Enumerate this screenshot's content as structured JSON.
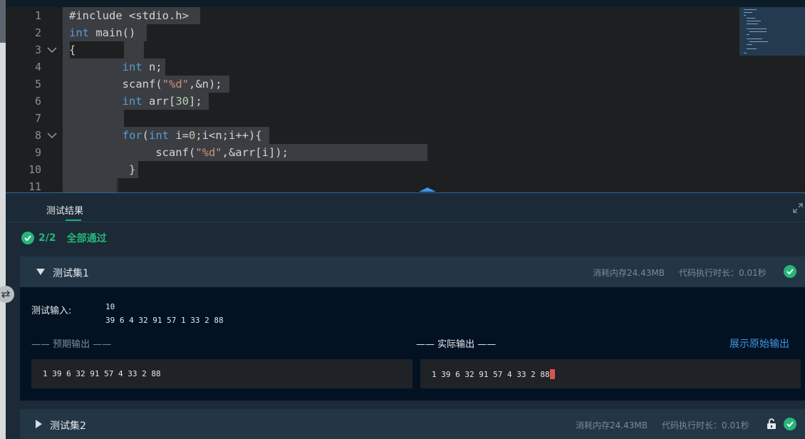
{
  "editor": {
    "line_numbers": [
      "1",
      "2",
      "3",
      "4",
      "5",
      "6",
      "7",
      "8",
      "9",
      "10",
      "11"
    ],
    "lines": [
      [
        {
          "t": "#include <stdio.h>",
          "c": ""
        }
      ],
      [
        {
          "t": "int",
          "c": "kw"
        },
        {
          "t": " main()",
          "c": ""
        }
      ],
      [
        {
          "t": "{",
          "c": ""
        }
      ],
      [
        {
          "t": "        ",
          "c": ""
        },
        {
          "t": "int",
          "c": "kw"
        },
        {
          "t": " n;",
          "c": ""
        }
      ],
      [
        {
          "t": "        scanf(",
          "c": ""
        },
        {
          "t": "\"%d\"",
          "c": "str"
        },
        {
          "t": ",&n);",
          "c": ""
        }
      ],
      [
        {
          "t": "        ",
          "c": ""
        },
        {
          "t": "int",
          "c": "kw"
        },
        {
          "t": " arr[",
          "c": ""
        },
        {
          "t": "30",
          "c": "num"
        },
        {
          "t": "];",
          "c": ""
        }
      ],
      [
        {
          "t": "",
          "c": ""
        }
      ],
      [
        {
          "t": "        ",
          "c": ""
        },
        {
          "t": "for",
          "c": "kw"
        },
        {
          "t": "(",
          "c": ""
        },
        {
          "t": "int",
          "c": "kw"
        },
        {
          "t": " i=",
          "c": ""
        },
        {
          "t": "0",
          "c": "num"
        },
        {
          "t": ";i<n;i++){",
          "c": ""
        }
      ],
      [
        {
          "t": "             scanf(",
          "c": ""
        },
        {
          "t": "\"%d\"",
          "c": "str"
        },
        {
          "t": ",&arr[i]);",
          "c": ""
        }
      ],
      [
        {
          "t": "         }",
          "c": ""
        }
      ],
      [
        {
          "t": "",
          "c": ""
        }
      ]
    ]
  },
  "results": {
    "tab_label": "测试结果",
    "passed_count": "2/2",
    "pass_text": "全部通过",
    "sets": [
      {
        "title": "测试集1",
        "memory": "消耗内存24.43MB",
        "time": "代码执行时长：0.01秒",
        "input_label": "测试输入:",
        "input_lines": [
          "10",
          "39 6 4 32 91 57 1 33 2 88"
        ],
        "expected_label": "—— 预期输出 ——",
        "actual_label": "—— 实际输出 ——",
        "raw_output_link": "展示原始输出",
        "expected_output": "1 39 6 32 91 57 4 33 2 88",
        "actual_output": "1 39 6 32 91 57 4 33 2 88"
      },
      {
        "title": "测试集2",
        "memory": "消耗内存24.43MB",
        "time": "代码执行时长：0.01秒"
      }
    ]
  },
  "colors": {
    "accent_green": "#27b57a",
    "link_blue": "#3f97e8",
    "caret_red": "#d9534f"
  }
}
